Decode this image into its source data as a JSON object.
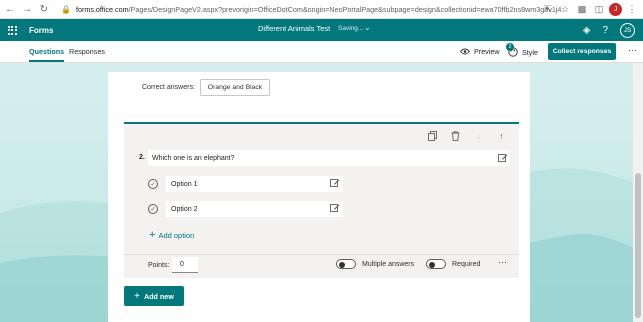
{
  "browser": {
    "url_host": "forms.office.com",
    "url_rest": "/Pages/DesignPageV2.aspx?prevorigin=OfficeDotCom&origin=NeoPortalPage&subpage=design&collectionid=ewa70ffb2ns8wm3gav1j4...",
    "profile_initial": "J"
  },
  "appbar": {
    "app_name": "Forms",
    "doc_title": "Different Animals Test",
    "status": "Saving...",
    "avatar_initials": "JS"
  },
  "commandbar": {
    "tabs": [
      {
        "label": "Questions"
      },
      {
        "label": "Responses"
      }
    ],
    "preview_label": "Preview",
    "style_label": "Style",
    "style_badge": "2",
    "collect_label": "Collect responses"
  },
  "previous_question": {
    "correct_answers_label": "Correct answers:",
    "correct_answers_value": "Orange and Black"
  },
  "question": {
    "number": "2.",
    "text": "Which one is an elephant?",
    "options": [
      {
        "label": "Option 1"
      },
      {
        "label": "Option 2"
      }
    ],
    "add_option_label": "Add option",
    "points_label": "Points:",
    "points_value": "0",
    "multiple_answers_label": "Multiple answers",
    "required_label": "Required"
  },
  "add_new_label": "Add new",
  "colors": {
    "accent": "#03787c",
    "panel": "#f3f2f1"
  }
}
